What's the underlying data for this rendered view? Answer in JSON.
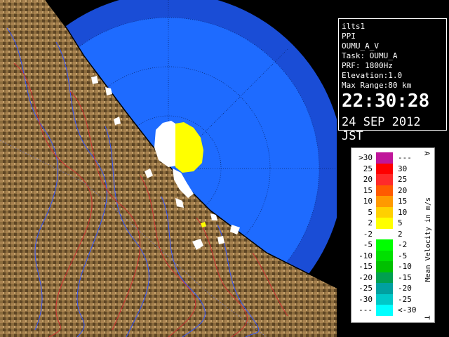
{
  "header": {
    "site": "ilts1",
    "product": "PPI",
    "sensor": "OUMU_A_V",
    "task": "Task: OUMU_A",
    "prf": "PRF: 1800Hz",
    "elevation": "Elevation:1.0",
    "max_range": "Max Range:80 km",
    "time": "22:30:28",
    "date": "24 SEP 2012 JST"
  },
  "legend": {
    "title": "Mean Velocity in m/s",
    "top_marker": "A",
    "bottom_marker": "T",
    "rows": [
      {
        "left": ">30",
        "right": "---",
        "color": "#c0169a"
      },
      {
        "left": "25",
        "right": "30",
        "color": "#ff0000"
      },
      {
        "left": "20",
        "right": "25",
        "color": "#ff2a2a"
      },
      {
        "left": "15",
        "right": "20",
        "color": "#ff5a00"
      },
      {
        "left": "10",
        "right": "15",
        "color": "#ff9900"
      },
      {
        "left": "5",
        "right": "10",
        "color": "#ffd000"
      },
      {
        "left": "2",
        "right": "5",
        "color": "#ffff00"
      },
      {
        "left": "-2",
        "right": "2",
        "color": "#ffffff"
      },
      {
        "left": "-5",
        "right": "-2",
        "color": "#00ff00"
      },
      {
        "left": "-10",
        "right": "-5",
        "color": "#00e000"
      },
      {
        "left": "-15",
        "right": "-10",
        "color": "#00c000"
      },
      {
        "left": "-20",
        "right": "-15",
        "color": "#00a050"
      },
      {
        "left": "-25",
        "right": "-20",
        "color": "#00a0a0"
      },
      {
        "left": "-30",
        "right": "-25",
        "color": "#00c8c8"
      },
      {
        "left": "---",
        "right": "<-30",
        "color": "#00ffff"
      }
    ]
  },
  "colors": {
    "radar_fill": "#1e6bff",
    "outer_ring": "#1a4dd6",
    "terrain": "#8a6a3a",
    "coast_line": "#000000",
    "river": "#3355ff",
    "road": "#d03030"
  }
}
